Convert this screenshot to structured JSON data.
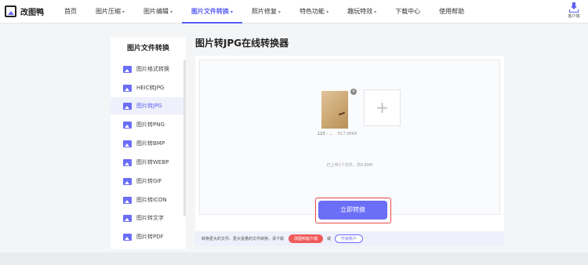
{
  "app": {
    "name": "改图鸭"
  },
  "nav": {
    "items": [
      {
        "label": "首页",
        "caret": false,
        "active": false
      },
      {
        "label": "图片压缩",
        "caret": true,
        "active": false
      },
      {
        "label": "图片编辑",
        "caret": true,
        "active": false
      },
      {
        "label": "图片文件转换",
        "caret": true,
        "active": true
      },
      {
        "label": "照片修复",
        "caret": true,
        "active": false
      },
      {
        "label": "特色功能",
        "caret": true,
        "active": false
      },
      {
        "label": "趣玩特效",
        "caret": true,
        "active": false
      },
      {
        "label": "下载中心",
        "caret": false,
        "active": false
      },
      {
        "label": "使用帮助",
        "caret": false,
        "active": false
      }
    ],
    "caret_glyph": "▾",
    "client_label": "客户端"
  },
  "sidebar": {
    "title": "图片文件转换",
    "items": [
      {
        "label": "图片格式转换"
      },
      {
        "label": "HEIC转JPG"
      },
      {
        "label": "图片转JPG"
      },
      {
        "label": "图片转PNG"
      },
      {
        "label": "图片转BMP"
      },
      {
        "label": "图片转WEBP"
      },
      {
        "label": "图片转GIF"
      },
      {
        "label": "图片转ICON"
      },
      {
        "label": "图片转文字"
      },
      {
        "label": "图片转PDF"
      }
    ],
    "active_index": 2
  },
  "main": {
    "title": "图片转JPG在线转换器",
    "file": {
      "name": "123 - ...",
      "size": "617.98KB"
    },
    "close_glyph": "×",
    "add_glyph": "+",
    "upload_info": "已上传1个文件，共0.60M",
    "convert_label": "立即转换",
    "bottom": {
      "text": "转换更大的文件、更大批量的文件转换，请下载",
      "download_client": "改图鸭客户端",
      "or": "或",
      "upgrade": "升级账户"
    }
  },
  "colors": {
    "accent": "#5b5ff2",
    "button": "#6b6ef6",
    "highlight_border": "#e84a4a"
  }
}
